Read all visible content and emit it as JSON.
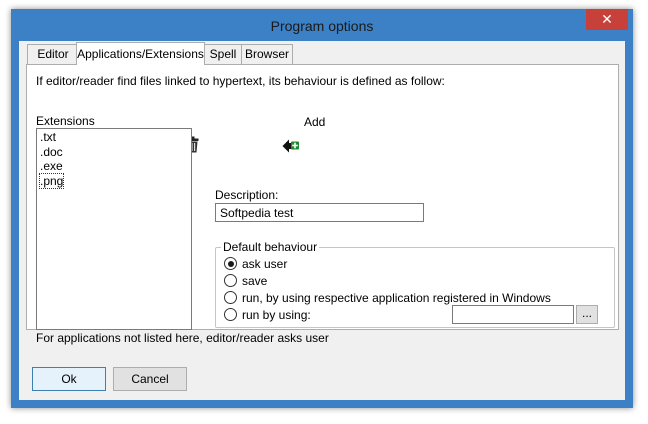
{
  "window": {
    "title": "Program options",
    "close_glyph": "✕"
  },
  "tabs": [
    {
      "label": "Editor",
      "active": false
    },
    {
      "label": "Applications/Extensions",
      "active": true
    },
    {
      "label": "Spell",
      "active": false
    },
    {
      "label": "Browser",
      "active": false
    }
  ],
  "panel": {
    "intro": "If editor/reader find files linked to hypertext, its behaviour is defined as follow:",
    "extensions_label": "Extensions",
    "extensions": [
      ".txt",
      ".doc",
      ".exe",
      ".png"
    ],
    "focused_extension": ".png",
    "delete_icon": "trash-icon",
    "add_icon": "add-arrow-icon",
    "add_label": "Add",
    "description_label": "Description:",
    "description_value": "Softpedia test",
    "default_behaviour": {
      "legend": "Default behaviour",
      "options": [
        {
          "label": "ask user",
          "checked": true
        },
        {
          "label": "save",
          "checked": false
        },
        {
          "label": "run, by using respective application registered in Windows",
          "checked": false
        },
        {
          "label": "run by using:",
          "checked": false
        }
      ],
      "run_by_using_value": "",
      "browse_label": "..."
    }
  },
  "footer_note": "For applications not listed here, editor/reader asks user",
  "buttons": {
    "ok": "Ok",
    "cancel": "Cancel"
  },
  "colors": {
    "title_bar": "#3c80c5",
    "close_button": "#c7403a",
    "add_icon": "#1f8a2e"
  }
}
